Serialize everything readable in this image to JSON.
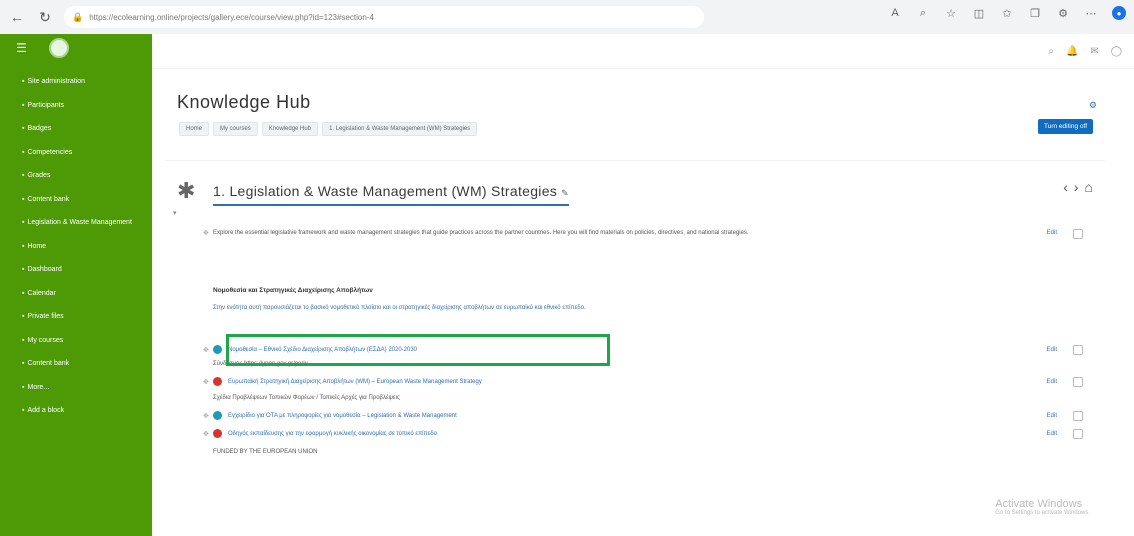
{
  "browser": {
    "url": "https://ecolearning.online/projects/gallery.ece/course/view.php?id=123#section-4"
  },
  "sidebar": {
    "items": [
      {
        "label": "Site administration"
      },
      {
        "label": "Participants"
      },
      {
        "label": "Badges"
      },
      {
        "label": "Competencies"
      },
      {
        "label": "Grades"
      },
      {
        "label": "Content bank"
      },
      {
        "label": "Legislation & Waste Management"
      },
      {
        "label": "Home"
      },
      {
        "label": "Dashboard"
      },
      {
        "label": "Calendar"
      },
      {
        "label": "Private files"
      },
      {
        "label": "My courses"
      },
      {
        "label": "Content bank"
      },
      {
        "label": "More..."
      },
      {
        "label": "Add a block"
      }
    ]
  },
  "header": {
    "title": "Knowledge Hub",
    "breadcrumbs": [
      "Home",
      "My courses",
      "Knowledge Hub",
      "1. Legislation & Waste Management (WM) Strategies"
    ],
    "edit_button": "Turn editing off"
  },
  "section": {
    "title": "1. Legislation & Waste Management (WM) Strategies",
    "intro": "Explore the essential legislative framework and waste management strategies that guide practices across the partner countries. Here you will find materials on policies, directives, and national strategies.",
    "subheading": "Νομοθεσία και Στρατηγικές Διαχείρισης Αποβλήτων",
    "paragraph": "Στην ενότητα αυτή παρουσιάζεται το βασικό νομοθετικό πλαίσιο και οι στρατηγικές διαχείρισης αποβλήτων σε ευρωπαϊκό και εθνικό επίπεδο.",
    "activities": [
      {
        "text": "Νομοθεσία – Εθνικό Σχέδιο Διαχείρισης Αποβλήτων (ΕΣΔΑ) 2020-2030",
        "color": "#1e9bb0",
        "edit": "Edit"
      },
      {
        "text": "Ευρωπαϊκή Στρατηγική Διαχείρισης Αποβλήτων (WM) – European Waste Management Strategy",
        "color": "#d9342b",
        "edit": "Edit"
      },
      {
        "text": "Εγχειρίδιο για ΟΤΑ με πληροφορίες για νομοθεσία – Legislation & Waste Management",
        "color": "#1e9bb0",
        "edit": "Edit"
      },
      {
        "text": "Οδηγός εκπαίδευσης για την εφαρμογή κυκλικής οικονομίας σε τοπικό επίπεδο",
        "color": "#d9342b",
        "edit": "Edit"
      }
    ],
    "labels": [
      "Σύνδεσμοι: https://ypen.gov.gr/periv",
      "Σχέδια Προβλέψεων Τοπικών Φορέων / Τοπικές Αρχές για Προβλέψεις"
    ],
    "footer": "FUNDED BY THE EUROPEAN UNION",
    "edit_label": "Edit"
  },
  "watermark": {
    "title": "Activate Windows",
    "subtitle": "Go to Settings to activate Windows."
  }
}
